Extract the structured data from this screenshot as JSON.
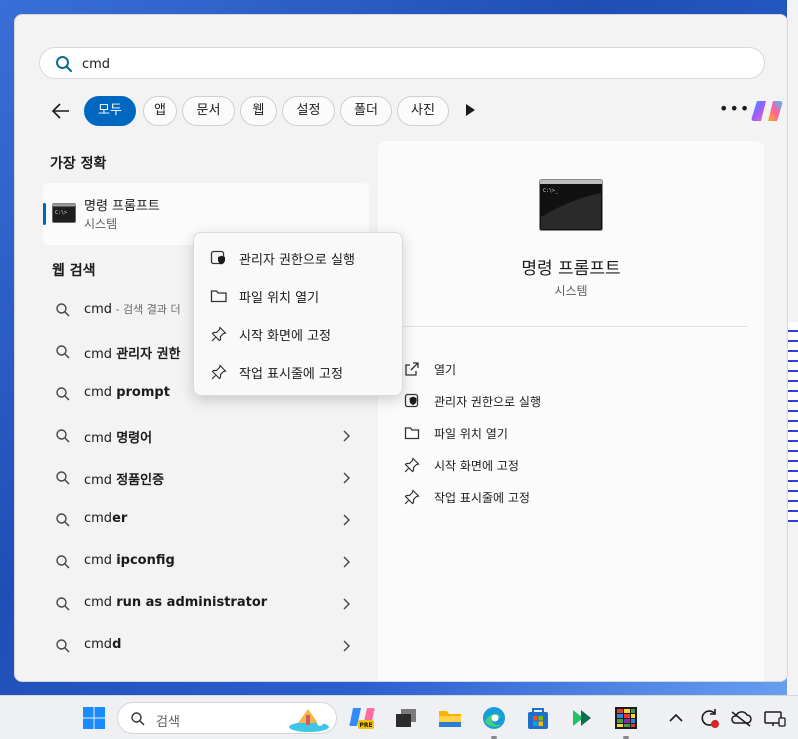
{
  "search": {
    "query": "cmd"
  },
  "filters": {
    "tabs": [
      {
        "label": "모두",
        "active": true
      },
      {
        "label": "앱"
      },
      {
        "label": "문서"
      },
      {
        "label": "웹"
      },
      {
        "label": "설정"
      },
      {
        "label": "폴더"
      },
      {
        "label": "사진"
      }
    ]
  },
  "best_match": {
    "title": "가장 정확",
    "name": "명령 프롬프트",
    "sub": "시스템"
  },
  "web": {
    "title": "웹 검색",
    "items": [
      {
        "prefix": "cmd",
        "bold": "",
        "muted": " - 검색 결과 더"
      },
      {
        "prefix": "cmd ",
        "bold": "관리자 권한"
      },
      {
        "prefix": "cmd ",
        "bold": "prompt"
      },
      {
        "prefix": "cmd ",
        "bold": "명령어"
      },
      {
        "prefix": "cmd ",
        "bold": "정품인증"
      },
      {
        "prefix": "cmd",
        "bold": "er"
      },
      {
        "prefix": "cmd ",
        "bold": "ipconfig"
      },
      {
        "prefix": "cmd ",
        "bold": "run as administrator"
      },
      {
        "prefix": "cmd",
        "bold": "d"
      }
    ]
  },
  "context_menu": {
    "items": [
      {
        "label": "관리자 권한으로 실행",
        "icon": "shield-icon"
      },
      {
        "label": "파일 위치 열기",
        "icon": "folder-icon"
      },
      {
        "label": "시작 화면에 고정",
        "icon": "pin-icon"
      },
      {
        "label": "작업 표시줄에 고정",
        "icon": "pin-icon"
      }
    ]
  },
  "preview": {
    "title": "명령 프롬프트",
    "sub": "시스템",
    "actions": [
      {
        "label": "열기",
        "icon": "open-external-icon"
      },
      {
        "label": "관리자 권한으로 실행",
        "icon": "shield-icon"
      },
      {
        "label": "파일 위치 열기",
        "icon": "folder-icon"
      },
      {
        "label": "시작 화면에 고정",
        "icon": "pin-icon"
      },
      {
        "label": "작업 표시줄에 고정",
        "icon": "pin-icon"
      }
    ]
  },
  "taskbar": {
    "search_label": "검색"
  },
  "colors": {
    "accent": "#0067c0"
  }
}
